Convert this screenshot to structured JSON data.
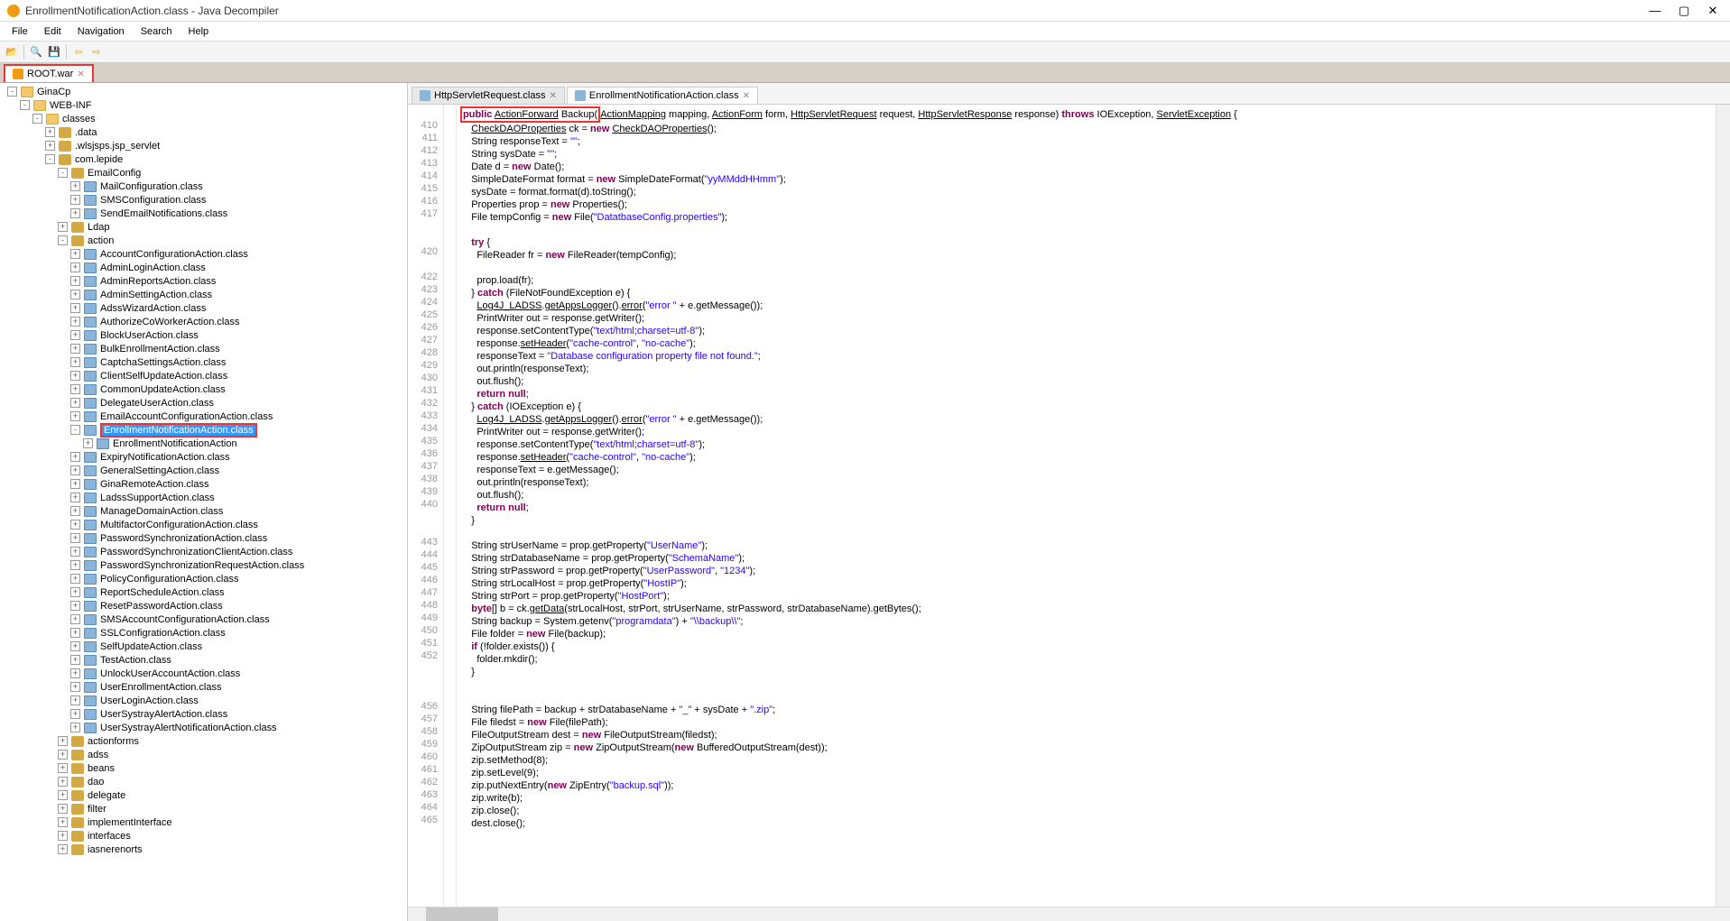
{
  "title": "EnrollmentNotificationAction.class - Java Decompiler",
  "menu": [
    "File",
    "Edit",
    "Navigation",
    "Search",
    "Help"
  ],
  "file_tab": {
    "label": "ROOT.war",
    "close": "✕"
  },
  "tree": [
    {
      "d": 0,
      "t": "-",
      "i": "folder",
      "l": "GinaCp"
    },
    {
      "d": 1,
      "t": "-",
      "i": "folder",
      "l": "WEB-INF"
    },
    {
      "d": 2,
      "t": "-",
      "i": "folder",
      "l": "classes"
    },
    {
      "d": 3,
      "t": "+",
      "i": "pkg",
      "l": ".data"
    },
    {
      "d": 3,
      "t": "+",
      "i": "pkg",
      "l": ".wlsjsps.jsp_servlet"
    },
    {
      "d": 3,
      "t": "-",
      "i": "pkg",
      "l": "com.lepide"
    },
    {
      "d": 4,
      "t": "-",
      "i": "pkg",
      "l": "EmailConfig"
    },
    {
      "d": 5,
      "t": "+",
      "i": "class",
      "l": "MailConfiguration.class"
    },
    {
      "d": 5,
      "t": "+",
      "i": "class",
      "l": "SMSConfiguration.class"
    },
    {
      "d": 5,
      "t": "+",
      "i": "class",
      "l": "SendEmailNotifications.class"
    },
    {
      "d": 4,
      "t": "+",
      "i": "pkg",
      "l": "Ldap"
    },
    {
      "d": 4,
      "t": "-",
      "i": "pkg",
      "l": "action"
    },
    {
      "d": 5,
      "t": "+",
      "i": "class",
      "l": "AccountConfigurationAction.class"
    },
    {
      "d": 5,
      "t": "+",
      "i": "class",
      "l": "AdminLoginAction.class"
    },
    {
      "d": 5,
      "t": "+",
      "i": "class",
      "l": "AdminReportsAction.class"
    },
    {
      "d": 5,
      "t": "+",
      "i": "class",
      "l": "AdminSettingAction.class"
    },
    {
      "d": 5,
      "t": "+",
      "i": "class",
      "l": "AdssWizardAction.class"
    },
    {
      "d": 5,
      "t": "+",
      "i": "class",
      "l": "AuthorizeCoWorkerAction.class"
    },
    {
      "d": 5,
      "t": "+",
      "i": "class",
      "l": "BlockUserAction.class"
    },
    {
      "d": 5,
      "t": "+",
      "i": "class",
      "l": "BulkEnrollmentAction.class"
    },
    {
      "d": 5,
      "t": "+",
      "i": "class",
      "l": "CaptchaSettingsAction.class"
    },
    {
      "d": 5,
      "t": "+",
      "i": "class",
      "l": "ClientSelfUpdateAction.class"
    },
    {
      "d": 5,
      "t": "+",
      "i": "class",
      "l": "CommonUpdateAction.class"
    },
    {
      "d": 5,
      "t": "+",
      "i": "class",
      "l": "DelegateUserAction.class"
    },
    {
      "d": 5,
      "t": "+",
      "i": "class",
      "l": "EmailAccountConfigurationAction.class"
    },
    {
      "d": 5,
      "t": "-",
      "i": "class",
      "l": "EnrollmentNotificationAction.class",
      "sel": true
    },
    {
      "d": 6,
      "t": "+",
      "i": "class",
      "l": "EnrollmentNotificationAction"
    },
    {
      "d": 5,
      "t": "+",
      "i": "class",
      "l": "ExpiryNotificationAction.class"
    },
    {
      "d": 5,
      "t": "+",
      "i": "class",
      "l": "GeneralSettingAction.class"
    },
    {
      "d": 5,
      "t": "+",
      "i": "class",
      "l": "GinaRemoteAction.class"
    },
    {
      "d": 5,
      "t": "+",
      "i": "class",
      "l": "LadssSupportAction.class"
    },
    {
      "d": 5,
      "t": "+",
      "i": "class",
      "l": "ManageDomainAction.class"
    },
    {
      "d": 5,
      "t": "+",
      "i": "class",
      "l": "MultifactorConfigurationAction.class"
    },
    {
      "d": 5,
      "t": "+",
      "i": "class",
      "l": "PasswordSynchronizationAction.class"
    },
    {
      "d": 5,
      "t": "+",
      "i": "class",
      "l": "PasswordSynchronizationClientAction.class"
    },
    {
      "d": 5,
      "t": "+",
      "i": "class",
      "l": "PasswordSynchronizationRequestAction.class"
    },
    {
      "d": 5,
      "t": "+",
      "i": "class",
      "l": "PolicyConfigurationAction.class"
    },
    {
      "d": 5,
      "t": "+",
      "i": "class",
      "l": "ReportScheduleAction.class"
    },
    {
      "d": 5,
      "t": "+",
      "i": "class",
      "l": "ResetPasswordAction.class"
    },
    {
      "d": 5,
      "t": "+",
      "i": "class",
      "l": "SMSAccountConfigurationAction.class"
    },
    {
      "d": 5,
      "t": "+",
      "i": "class",
      "l": "SSLConfigrationAction.class"
    },
    {
      "d": 5,
      "t": "+",
      "i": "class",
      "l": "SelfUpdateAction.class"
    },
    {
      "d": 5,
      "t": "+",
      "i": "class",
      "l": "TestAction.class"
    },
    {
      "d": 5,
      "t": "+",
      "i": "class",
      "l": "UnlockUserAccountAction.class"
    },
    {
      "d": 5,
      "t": "+",
      "i": "class",
      "l": "UserEnrollmentAction.class"
    },
    {
      "d": 5,
      "t": "+",
      "i": "class",
      "l": "UserLoginAction.class"
    },
    {
      "d": 5,
      "t": "+",
      "i": "class",
      "l": "UserSystrayAlertAction.class"
    },
    {
      "d": 5,
      "t": "+",
      "i": "class",
      "l": "UserSystrayAlertNotificationAction.class"
    },
    {
      "d": 4,
      "t": "+",
      "i": "pkg",
      "l": "actionforms"
    },
    {
      "d": 4,
      "t": "+",
      "i": "pkg",
      "l": "adss"
    },
    {
      "d": 4,
      "t": "+",
      "i": "pkg",
      "l": "beans"
    },
    {
      "d": 4,
      "t": "+",
      "i": "pkg",
      "l": "dao"
    },
    {
      "d": 4,
      "t": "+",
      "i": "pkg",
      "l": "delegate"
    },
    {
      "d": 4,
      "t": "+",
      "i": "pkg",
      "l": "filter"
    },
    {
      "d": 4,
      "t": "+",
      "i": "pkg",
      "l": "implementInterface"
    },
    {
      "d": 4,
      "t": "+",
      "i": "pkg",
      "l": "interfaces"
    },
    {
      "d": 4,
      "t": "+",
      "i": "pkg",
      "l": "iasnerenorts"
    }
  ],
  "editor_tabs": [
    {
      "label": "HttpServletRequest.class",
      "active": false
    },
    {
      "label": "EnrollmentNotificationAction.class",
      "active": true
    }
  ],
  "code_lines": [
    {
      "n": "",
      "hl": true,
      "html": "  <span class=\"kw\">public</span> <span class=\"id-u\">ActionForward</span> Backup(<span class=\"id-u\">ActionMapping</span> mapping, <span class=\"id-u\">ActionForm</span> form, <span class=\"id-u\">HttpServletRequest</span> request, <span class=\"id-u\">HttpServletResponse</span> response) <span class=\"kw\">throws</span> IOException, <span class=\"id-u\">ServletException</span> {"
    },
    {
      "n": "410",
      "html": "    <span class=\"id-u\">CheckDAOProperties</span> ck = <span class=\"kw\">new</span> <span class=\"id-u\">CheckDAOProperties</span>();"
    },
    {
      "n": "411",
      "html": "    String responseText = <span class=\"str\">\"\"</span>;"
    },
    {
      "n": "412",
      "html": "    String sysDate = <span class=\"str\">\"\"</span>;"
    },
    {
      "n": "413",
      "html": "    Date d = <span class=\"kw\">new</span> Date();"
    },
    {
      "n": "414",
      "html": "    SimpleDateFormat format = <span class=\"kw\">new</span> SimpleDateFormat(<span class=\"str\">\"yyMMddHHmm\"</span>);"
    },
    {
      "n": "415",
      "html": "    sysDate = format.format(d).toString();"
    },
    {
      "n": "416",
      "html": "    Properties prop = <span class=\"kw\">new</span> Properties();"
    },
    {
      "n": "417",
      "html": "    File tempConfig = <span class=\"kw\">new</span> File(<span class=\"str\">\"DatatbaseConfig.properties\"</span>);"
    },
    {
      "n": "",
      "html": ""
    },
    {
      "n": "",
      "html": "    <span class=\"kw\">try</span> {"
    },
    {
      "n": "420",
      "html": "      FileReader fr = <span class=\"kw\">new</span> FileReader(tempConfig);"
    },
    {
      "n": "",
      "html": ""
    },
    {
      "n": "422",
      "html": "      prop.load(fr);"
    },
    {
      "n": "423",
      "html": "    } <span class=\"kw\">catch</span> (FileNotFoundException e) {"
    },
    {
      "n": "424",
      "html": "      <span class=\"id-u\">Log4J_LADSS</span>.<span class=\"id-u\">getAppsLogger</span>().<span class=\"id-u\">error</span>(<span class=\"str\">\"error \"</span> + e.getMessage());"
    },
    {
      "n": "425",
      "html": "      PrintWriter out = response.getWriter();"
    },
    {
      "n": "426",
      "html": "      response.setContentType(<span class=\"str\">\"text/html;charset=utf-8\"</span>);"
    },
    {
      "n": "427",
      "html": "      response.<span class=\"id-u\">setHeader</span>(<span class=\"str\">\"cache-control\"</span>, <span class=\"str\">\"no-cache\"</span>);"
    },
    {
      "n": "428",
      "html": "      responseText = <span class=\"str\">\"Database configuration property file not found.\"</span>;"
    },
    {
      "n": "429",
      "html": "      out.println(responseText);"
    },
    {
      "n": "430",
      "html": "      out.flush();"
    },
    {
      "n": "431",
      "html": "      <span class=\"kw\">return null</span>;"
    },
    {
      "n": "432",
      "html": "    } <span class=\"kw\">catch</span> (IOException e) {"
    },
    {
      "n": "433",
      "html": "      <span class=\"id-u\">Log4J_LADSS</span>.<span class=\"id-u\">getAppsLogger</span>().<span class=\"id-u\">error</span>(<span class=\"str\">\"error \"</span> + e.getMessage());"
    },
    {
      "n": "434",
      "html": "      PrintWriter out = response.getWriter();"
    },
    {
      "n": "435",
      "html": "      response.setContentType(<span class=\"str\">\"text/html;charset=utf-8\"</span>);"
    },
    {
      "n": "436",
      "html": "      response.<span class=\"id-u\">setHeader</span>(<span class=\"str\">\"cache-control\"</span>, <span class=\"str\">\"no-cache\"</span>);"
    },
    {
      "n": "437",
      "html": "      responseText = e.getMessage();"
    },
    {
      "n": "438",
      "html": "      out.println(responseText);"
    },
    {
      "n": "439",
      "html": "      out.flush();"
    },
    {
      "n": "440",
      "html": "      <span class=\"kw\">return null</span>;"
    },
    {
      "n": "",
      "html": "    }"
    },
    {
      "n": "",
      "html": ""
    },
    {
      "n": "443",
      "html": "    String strUserName = prop.getProperty(<span class=\"str\">\"UserName\"</span>);"
    },
    {
      "n": "444",
      "html": "    String strDatabaseName = prop.getProperty(<span class=\"str\">\"SchemaName\"</span>);"
    },
    {
      "n": "445",
      "html": "    String strPassword = prop.getProperty(<span class=\"str\">\"UserPassword\"</span>, <span class=\"str\">\"1234\"</span>);"
    },
    {
      "n": "446",
      "html": "    String strLocalHost = prop.getProperty(<span class=\"str\">\"HostIP\"</span>);"
    },
    {
      "n": "447",
      "html": "    String strPort = prop.getProperty(<span class=\"str\">\"HostPort\"</span>);"
    },
    {
      "n": "448",
      "html": "    <span class=\"kw\">byte</span>[] b = ck.<span class=\"id-u\">getData</span>(strLocalHost, strPort, strUserName, strPassword, strDatabaseName).getBytes();"
    },
    {
      "n": "449",
      "html": "    String backup = System.getenv(<span class=\"str\">\"programdata\"</span>) + <span class=\"str\">\"\\\\backup\\\\\"</span>;"
    },
    {
      "n": "450",
      "html": "    File folder = <span class=\"kw\">new</span> File(backup);"
    },
    {
      "n": "451",
      "html": "    <span class=\"kw\">if</span> (!folder.exists()) {"
    },
    {
      "n": "452",
      "html": "      folder.mkdir();"
    },
    {
      "n": "",
      "html": "    }"
    },
    {
      "n": "",
      "html": ""
    },
    {
      "n": "",
      "html": ""
    },
    {
      "n": "456",
      "html": "    String filePath = backup + strDatabaseName + <span class=\"str\">\"_\"</span> + sysDate + <span class=\"str\">\".zip\"</span>;"
    },
    {
      "n": "457",
      "html": "    File filedst = <span class=\"kw\">new</span> File(filePath);"
    },
    {
      "n": "458",
      "html": "    FileOutputStream dest = <span class=\"kw\">new</span> FileOutputStream(filedst);"
    },
    {
      "n": "459",
      "html": "    ZipOutputStream zip = <span class=\"kw\">new</span> ZipOutputStream(<span class=\"kw\">new</span> BufferedOutputStream(dest));"
    },
    {
      "n": "460",
      "html": "    zip.setMethod(8);"
    },
    {
      "n": "461",
      "html": "    zip.setLevel(9);"
    },
    {
      "n": "462",
      "html": "    zip.putNextEntry(<span class=\"kw\">new</span> ZipEntry(<span class=\"str\">\"backup.sql\"</span>));"
    },
    {
      "n": "463",
      "html": "    zip.write(b);"
    },
    {
      "n": "464",
      "html": "    zip.close();"
    },
    {
      "n": "465",
      "html": "    dest.close();"
    }
  ]
}
